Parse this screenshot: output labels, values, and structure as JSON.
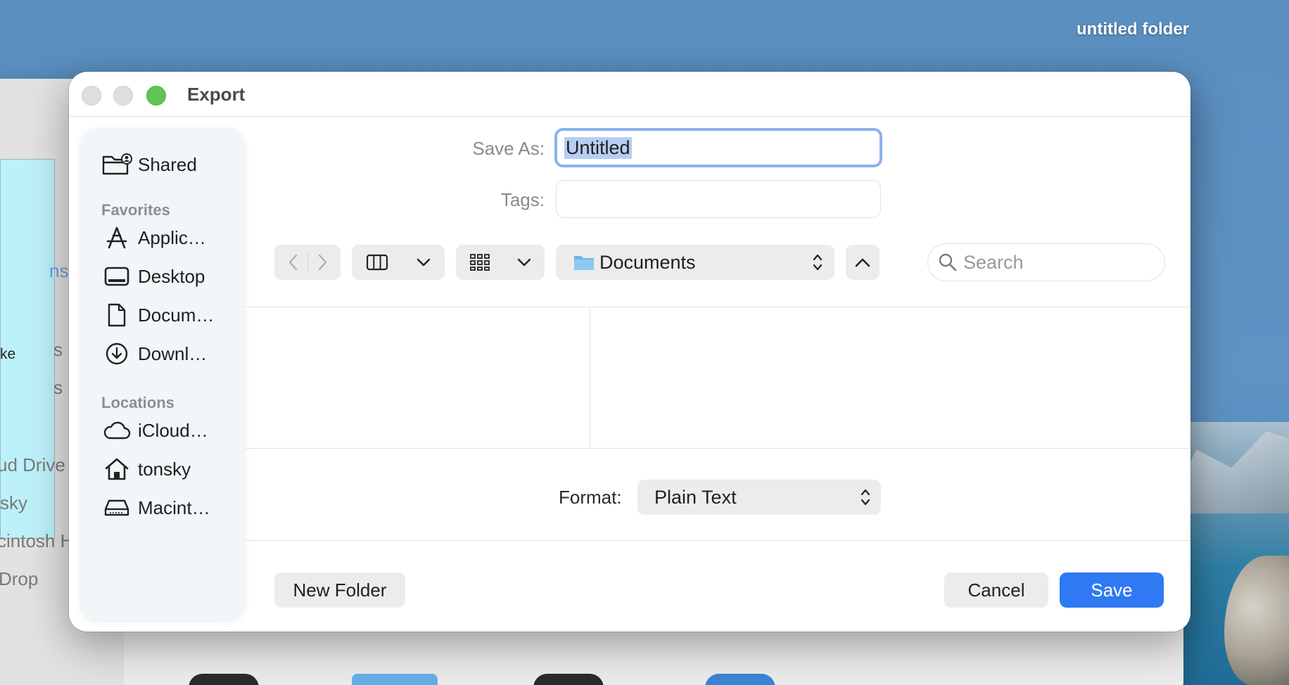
{
  "desktop": {
    "folder_label": "untitled folder"
  },
  "background_window": {
    "partial_texts": [
      "ns",
      "ke",
      "s",
      "s",
      "ud Drive",
      "sky",
      "cintosh HD",
      "Drop"
    ]
  },
  "dialog": {
    "title": "Export",
    "save_as_label": "Save As:",
    "save_as_value": "Untitled",
    "tags_label": "Tags:",
    "tags_value": "",
    "location": "Documents",
    "search_placeholder": "Search",
    "format_label": "Format:",
    "format_value": "Plain Text",
    "new_folder_label": "New Folder",
    "cancel_label": "Cancel",
    "save_label": "Save"
  },
  "sidebar": {
    "shared": "Shared",
    "favorites_header": "Favorites",
    "favorites": [
      {
        "label": "Applic…",
        "icon": "applications-icon"
      },
      {
        "label": "Desktop",
        "icon": "desktop-icon"
      },
      {
        "label": "Docum…",
        "icon": "document-icon"
      },
      {
        "label": "Downl…",
        "icon": "download-icon"
      }
    ],
    "locations_header": "Locations",
    "locations": [
      {
        "label": "iCloud…",
        "icon": "icloud-icon"
      },
      {
        "label": "tonsky",
        "icon": "home-icon"
      },
      {
        "label": "Macint…",
        "icon": "hard-drive-icon"
      }
    ]
  },
  "colors": {
    "accent": "#2f7af2",
    "focus_ring": "#8ab1ef",
    "zoom_button": "#5fc454"
  }
}
